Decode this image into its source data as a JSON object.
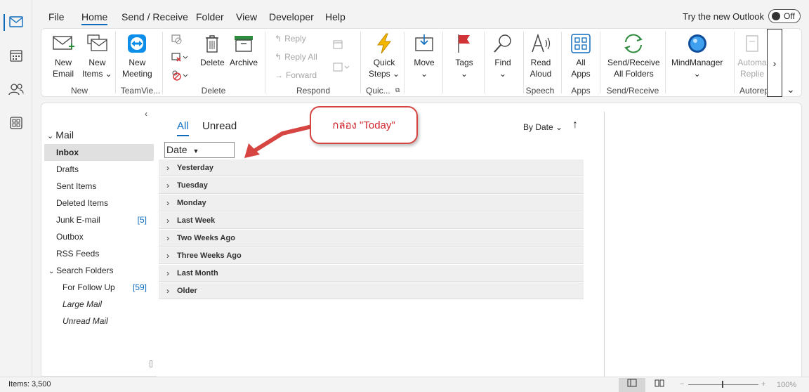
{
  "menu": {
    "tabs": [
      "File",
      "Home",
      "Send / Receive",
      "Folder",
      "View",
      "Developer",
      "Help"
    ],
    "active_tab": "Home",
    "try_new_outlook": "Try the new Outlook",
    "toggle_label": "Off"
  },
  "ribbon": {
    "new_email": "New Email",
    "new_email_l1": "New",
    "new_email_l2": "Email",
    "new_items_l1": "New",
    "new_items_l2": "Items ⌄",
    "group_new": "New",
    "new_meeting_l1": "New",
    "new_meeting_l2": "Meeting",
    "group_teamviewer": "TeamVie...",
    "delete": "Delete",
    "archive": "Archive",
    "group_delete": "Delete",
    "reply": "Reply",
    "reply_all": "Reply All",
    "forward": "Forward",
    "group_respond": "Respond",
    "quick_steps_l1": "Quick",
    "quick_steps_l2": "Steps ⌄",
    "group_quick": "Quic...",
    "move": "Move",
    "tags": "Tags",
    "find": "Find",
    "read_aloud_l1": "Read",
    "read_aloud_l2": "Aloud",
    "group_speech": "Speech",
    "all_apps_l1": "All",
    "all_apps_l2": "Apps",
    "group_apps": "Apps",
    "send_receive_l1": "Send/Receive",
    "send_receive_l2": "All Folders",
    "group_send_receive": "Send/Receive",
    "mindmanager": "MindManager",
    "auto_l1": "Automa",
    "auto_l2": "Replie",
    "group_autoreply": "Autorep",
    "more": "›",
    "collapse": "⌄",
    "accent_color": "#0f6cbd"
  },
  "folders": {
    "collapse": "‹",
    "mail_header": "Mail",
    "items": [
      {
        "label": "Inbox",
        "count": "",
        "selected": true
      },
      {
        "label": "Drafts",
        "count": ""
      },
      {
        "label": "Sent Items",
        "count": ""
      },
      {
        "label": "Deleted Items",
        "count": ""
      },
      {
        "label": "Junk E-mail",
        "count": "[5]"
      },
      {
        "label": "Outbox",
        "count": ""
      },
      {
        "label": "RSS Feeds",
        "count": ""
      }
    ],
    "search_folders_header": "Search Folders",
    "search_folders": [
      {
        "label": "For Follow Up",
        "count": "[59]"
      },
      {
        "label": "Large Mail",
        "count": ""
      },
      {
        "label": "Unread Mail",
        "count": ""
      }
    ]
  },
  "list": {
    "tab_all": "All",
    "tab_unread": "Unread",
    "sort_by": "By Date",
    "sort_arrow": "↑",
    "date_filter": "Date",
    "groups": [
      "Yesterday",
      "Tuesday",
      "Monday",
      "Last Week",
      "Two Weeks Ago",
      "Three Weeks Ago",
      "Last Month",
      "Older"
    ]
  },
  "annotation": {
    "text": "กล่อง \"Today\"",
    "color": "#d64541"
  },
  "status": {
    "items": "Items: 3,500",
    "zoom": "100%"
  }
}
